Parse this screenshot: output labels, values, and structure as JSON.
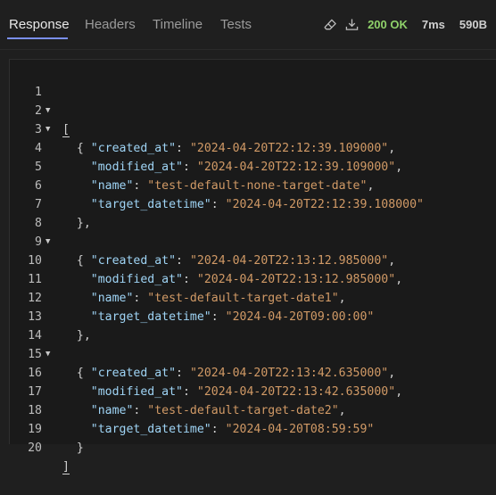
{
  "tabs": [
    {
      "label": "Response",
      "active": true
    },
    {
      "label": "Headers",
      "active": false
    },
    {
      "label": "Timeline",
      "active": false
    },
    {
      "label": "Tests",
      "active": false
    }
  ],
  "status": {
    "code_text": "200 OK",
    "time": "7ms",
    "size": "590B",
    "ok_color": "#8fd16a"
  },
  "icons": {
    "clear": "eraser-icon",
    "download": "download-icon"
  },
  "editor": {
    "lines": [
      {
        "n": "1",
        "fold": true
      },
      {
        "n": "2",
        "fold": true
      },
      {
        "n": "3",
        "fold": false
      },
      {
        "n": "4",
        "fold": false
      },
      {
        "n": "5",
        "fold": false
      },
      {
        "n": "6",
        "fold": false
      },
      {
        "n": "7",
        "fold": false
      },
      {
        "n": "8",
        "fold": true
      },
      {
        "n": "9",
        "fold": false
      },
      {
        "n": "10",
        "fold": false
      },
      {
        "n": "11",
        "fold": false
      },
      {
        "n": "12",
        "fold": false
      },
      {
        "n": "13",
        "fold": false
      },
      {
        "n": "14",
        "fold": true
      },
      {
        "n": "15",
        "fold": false
      },
      {
        "n": "16",
        "fold": false
      },
      {
        "n": "17",
        "fold": false
      },
      {
        "n": "18",
        "fold": false
      },
      {
        "n": "19",
        "fold": false
      },
      {
        "n": "20",
        "fold": false
      }
    ],
    "records": [
      {
        "created_at": "\"2024-04-20T22:12:39.109000\"",
        "modified_at": "\"2024-04-20T22:12:39.109000\"",
        "name": "\"test-default-none-target-date\"",
        "target_datetime": "\"2024-04-20T22:12:39.108000\""
      },
      {
        "created_at": "\"2024-04-20T22:13:12.985000\"",
        "modified_at": "\"2024-04-20T22:13:12.985000\"",
        "name": "\"test-default-target-date1\"",
        "target_datetime": "\"2024-04-20T09:00:00\""
      },
      {
        "created_at": "\"2024-04-20T22:13:42.635000\"",
        "modified_at": "\"2024-04-20T22:13:42.635000\"",
        "name": "\"test-default-target-date2\"",
        "target_datetime": "\"2024-04-20T08:59:59\""
      }
    ],
    "keys": {
      "created_at": "\"created_at\"",
      "modified_at": "\"modified_at\"",
      "name": "\"name\"",
      "target_datetime": "\"target_datetime\""
    },
    "punct": {
      "open_array": "[",
      "close_array": "]",
      "open_obj": "{",
      "close_obj_comma": "},",
      "close_obj": "}",
      "colon": ": ",
      "comma": ","
    },
    "fold_glyph": "▼"
  }
}
